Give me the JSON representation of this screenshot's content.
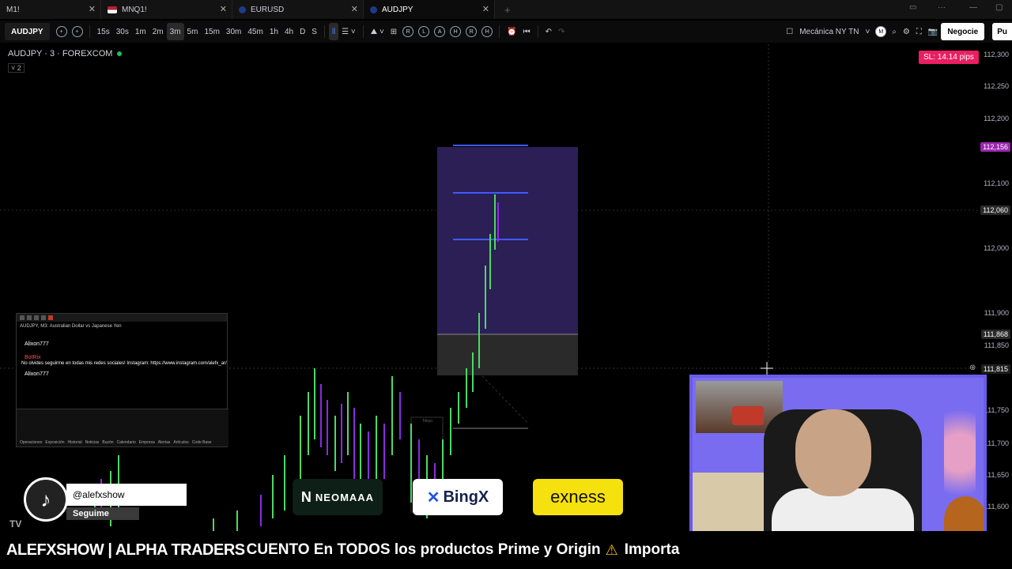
{
  "tabs": [
    {
      "label": "M1!",
      "active": false
    },
    {
      "label": "MNQ1!",
      "active": false
    },
    {
      "label": "EURUSD",
      "active": false
    },
    {
      "label": "AUDJPY",
      "active": true
    }
  ],
  "toolbar": {
    "symbol": "AUDJPY",
    "timeframes": [
      "15s",
      "30s",
      "1m",
      "2m",
      "3m",
      "5m",
      "15m",
      "30m",
      "45m",
      "1h",
      "4h",
      "D",
      "S"
    ],
    "selected_timeframe": "3m",
    "replay_letters": [
      "R",
      "L",
      "A",
      "H",
      "R",
      "H"
    ],
    "layout_name": "Mecánica NY TN",
    "trade_button": "Negocie",
    "publish_button": "Pu"
  },
  "chart": {
    "title": "AUDJPY · 3 · FOREXCOM",
    "layers_count": "2",
    "stop_loss_badge": "SL: 14.14 pips",
    "price_labels": [
      "112,300",
      "112,250",
      "112,200",
      "112,100",
      "112,000",
      "111,900",
      "111,850",
      "111,750",
      "111,700",
      "111,650",
      "111,600"
    ],
    "price_tags": [
      {
        "value": "112,156",
        "color": "#9c27b0"
      },
      {
        "value": "112,060",
        "color": "#2a2a2a"
      },
      {
        "value": "111,868",
        "color": "#2a2a2a"
      },
      {
        "value": "111,815",
        "color": "#1e1e1e"
      }
    ],
    "session_label": "Tokyo"
  },
  "mini_window": {
    "header_text": "AUDJPY, M3: Australian Dollar vs Japanese Yen",
    "user1": "Alixon777",
    "bot_name": "BotRix",
    "bot_message": "No olvides seguirme en todas mis redes sociales! Instagram: https://www.instagram.com/alefx_ar/",
    "user2": "Alixon777",
    "tabs": [
      "Operaciones",
      "Exposición",
      "Historial",
      "Noticias",
      "Buzón",
      "Calendario",
      "Empresa",
      "Alertas",
      "Artículos",
      "Code Base"
    ]
  },
  "social": {
    "handle": "@alefxshow",
    "follow_label": "Seguime"
  },
  "sponsors": {
    "neomaaa": "NEOMAAA",
    "bingx": "BingX",
    "exness": "exness"
  },
  "ticker": {
    "brand": "ALEFXSHOW | ALPHA TRADERS",
    "text1": "CUENTO En TODOS los productos Prime y Origin",
    "text2": "Importa"
  },
  "colors": {
    "bull_candle": "#4cd964",
    "bear_candle": "#8a2be2",
    "position_box": "#2b1f55",
    "sl_badge": "#e91e63",
    "target_line": "#3d5afe"
  }
}
